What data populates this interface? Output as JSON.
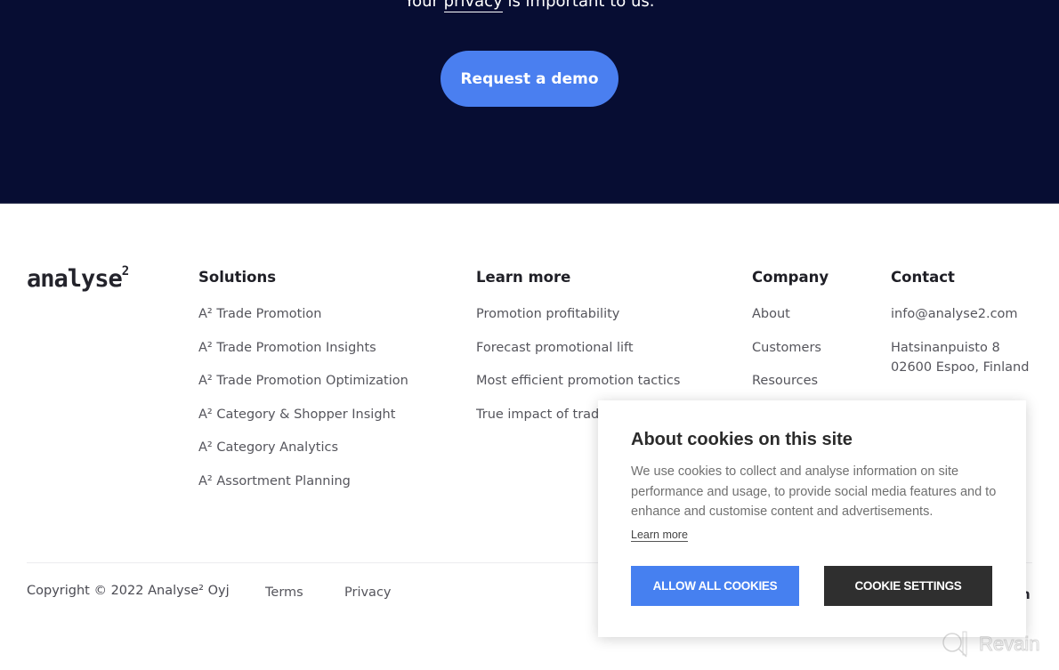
{
  "hero": {
    "text_before": "Your ",
    "privacy_link": "privacy",
    "text_after": " is important to us.",
    "demo_button": "Request a demo"
  },
  "footer": {
    "logo": {
      "text": "analyse",
      "sup": "2"
    },
    "columns": {
      "solutions": {
        "title": "Solutions",
        "items": [
          "A² Trade Promotion",
          "A² Trade Promotion Insights",
          "A² Trade Promotion Optimization",
          "A² Category & Shopper Insight",
          "A² Category Analytics",
          "A² Assortment Planning"
        ]
      },
      "learn_more": {
        "title": "Learn more",
        "items": [
          "Promotion profitability",
          "Forecast promotional lift",
          "Most efficient promotion tactics",
          "True impact of trad"
        ]
      },
      "company": {
        "title": "Company",
        "items": [
          "About",
          "Customers",
          "Resources"
        ]
      },
      "contact": {
        "title": "Contact",
        "email": "info@analyse2.com",
        "address_line1": "Hatsinanpuisto 8",
        "address_line2": "02600 Espoo, Finland"
      }
    },
    "copyright": "Copyright © 2022 Analyse² Oyj",
    "terms": "Terms",
    "privacy": "Privacy",
    "partial_text": "n"
  },
  "cookie_banner": {
    "title": "About cookies on this site",
    "body": "We use cookies to collect and analyse information on site performance and usage, to provide social media features and to enhance and customise content and advertisements.",
    "learn_more": "Learn more",
    "allow_button": "ALLOW ALL COOKIES",
    "settings_button": "COOKIE SETTINGS"
  },
  "watermark": {
    "text": "Revain"
  }
}
